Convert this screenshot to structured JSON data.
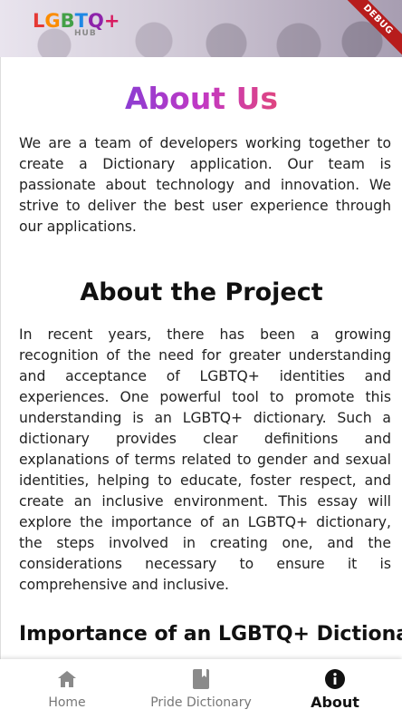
{
  "header": {
    "logo_text": "LGBTQ+",
    "logo_sub": "HUB",
    "logo_colors": [
      "#e53935",
      "#fb8c00",
      "#43a047",
      "#1e88e5",
      "#8e24aa",
      "#d81b60"
    ],
    "debug_banner": "DEBUG"
  },
  "content": {
    "title": "About Us",
    "intro": "We are a team of developers working together to create a Dictionary application. Our team is passionate about technology and innovation. We strive to deliver the best user experience through our applications.",
    "project_heading": "About the Project",
    "project_text": "In recent years, there has been a growing recognition of the need for greater understanding and acceptance of LGBTQ+ identities and experiences. One powerful tool to promote this understanding is an LGBTQ+ dictionary. Such a dictionary provides clear definitions and explanations of terms related to gender and sexual identities, helping to educate, foster respect, and create an inclusive environment. This essay will explore the importance of an LGBTQ+ dictionary, the steps involved in creating one, and the considerations necessary to ensure it is comprehensive and inclusive.",
    "importance_heading": "Importance of an LGBTQ+ Dictionary"
  },
  "bottom_nav": {
    "items": [
      {
        "label": "Home",
        "icon": "home-icon",
        "active": false
      },
      {
        "label": "Pride Dictionary",
        "icon": "book-icon",
        "active": false
      },
      {
        "label": "About",
        "icon": "info-icon",
        "active": true
      }
    ],
    "inactive_color": "#777777",
    "active_color": "#111111"
  }
}
